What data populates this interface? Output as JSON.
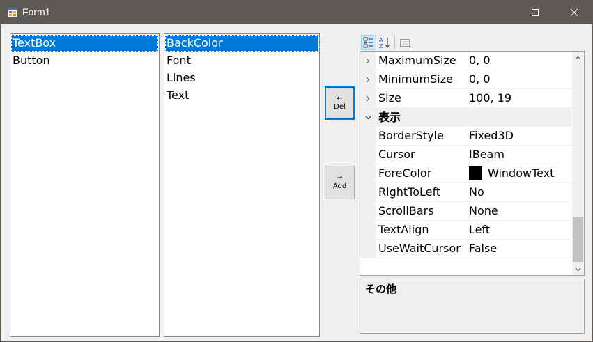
{
  "window": {
    "title": "Form1"
  },
  "list_controls": {
    "items": [
      "TextBox",
      "Button"
    ],
    "selected_index": 0
  },
  "list_properties": {
    "items": [
      "BackColor",
      "Font",
      "Lines",
      "Text"
    ],
    "selected_index": 0
  },
  "buttons": {
    "del": {
      "arrow": "←",
      "label": "Del"
    },
    "add": {
      "arrow": "→",
      "label": "Add"
    }
  },
  "property_grid": {
    "toolbar": {
      "icons": [
        "categorized-icon",
        "alphabetical-icon",
        "property-pages-icon"
      ]
    },
    "rows": [
      {
        "kind": "prop",
        "name": "MaximumSize",
        "value": "0, 0",
        "expandable": true
      },
      {
        "kind": "prop",
        "name": "MinimumSize",
        "value": "0, 0",
        "expandable": true
      },
      {
        "kind": "prop",
        "name": "Size",
        "value": "100, 19",
        "expandable": true
      },
      {
        "kind": "category",
        "name": "表示"
      },
      {
        "kind": "prop",
        "name": "BorderStyle",
        "value": "Fixed3D"
      },
      {
        "kind": "prop",
        "name": "Cursor",
        "value": "IBeam"
      },
      {
        "kind": "prop",
        "name": "ForeColor",
        "value": "WindowText",
        "swatch": "#000000"
      },
      {
        "kind": "prop",
        "name": "RightToLeft",
        "value": "No"
      },
      {
        "kind": "prop",
        "name": "ScrollBars",
        "value": "None"
      },
      {
        "kind": "prop",
        "name": "TextAlign",
        "value": "Left"
      },
      {
        "kind": "prop",
        "name": "UseWaitCursor",
        "value": "False"
      }
    ],
    "help": {
      "title": "その他"
    }
  },
  "colors": {
    "selection": "#0078d7",
    "titlebar": "#5d5a56",
    "focus_border": "#0078d7"
  }
}
